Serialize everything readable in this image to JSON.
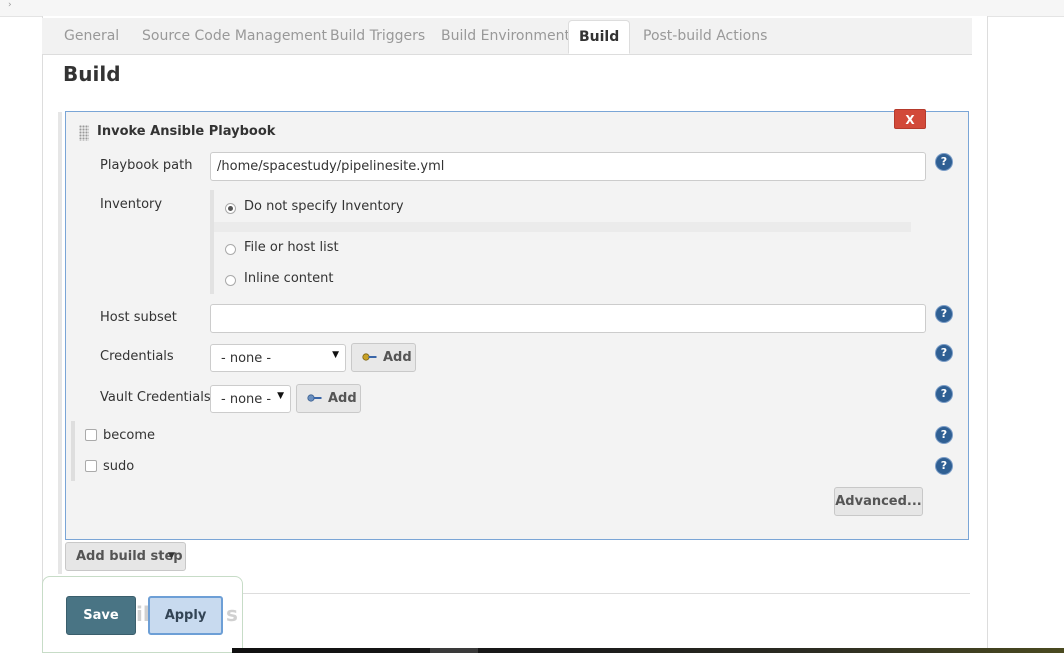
{
  "tabs": [
    {
      "label": "General"
    },
    {
      "label": "Source Code Management"
    },
    {
      "label": "Build Triggers"
    },
    {
      "label": "Build Environment"
    },
    {
      "label": "Build",
      "active": true
    },
    {
      "label": "Post-build Actions"
    }
  ],
  "section_title": "Build",
  "build_step": {
    "title": "Invoke Ansible Playbook",
    "delete_label": "X",
    "playbook_path": {
      "label": "Playbook path",
      "value": "/home/spacestudy/pipelinesite.yml"
    },
    "inventory": {
      "label": "Inventory",
      "options": [
        {
          "label": "Do not specify Inventory",
          "selected": true
        },
        {
          "label": "File or host list",
          "selected": false
        },
        {
          "label": "Inline content",
          "selected": false
        }
      ]
    },
    "host_subset": {
      "label": "Host subset",
      "value": ""
    },
    "credentials": {
      "label": "Credentials",
      "selected": "- none -",
      "add_label": "Add"
    },
    "vault_credentials": {
      "label": "Vault Credentials",
      "selected": "- none -",
      "add_label": "Add"
    },
    "become": {
      "label": "become",
      "checked": false
    },
    "sudo": {
      "label": "sudo",
      "checked": false
    },
    "advanced_label": "Advanced...",
    "help_glyph": "?"
  },
  "add_build_step_label": "Add build step",
  "ghost_text": {
    "left": "il",
    "right": "s"
  },
  "footer": {
    "save_label": "Save",
    "apply_label": "Apply"
  },
  "colors": {
    "accent": "#497484",
    "delete": "#d24939",
    "help": "#2f5f93",
    "step_border": "#7aa5d6"
  },
  "icons": [
    "key-icon",
    "help-icon",
    "caret-down-icon",
    "drag-handle-icon"
  ]
}
